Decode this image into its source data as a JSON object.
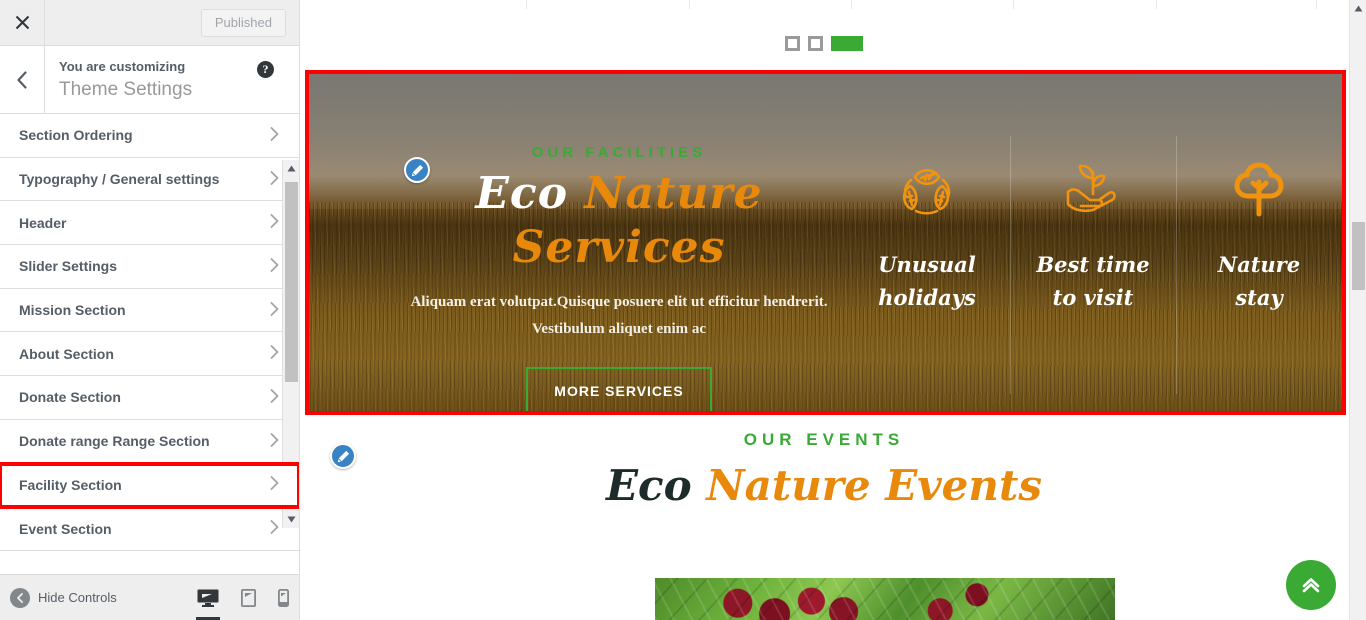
{
  "customizer": {
    "close_label": "Close",
    "publish_label": "Published",
    "back_label": "Back",
    "subtitle": "You are customizing",
    "title": "Theme Settings",
    "help_label": "?",
    "hide_controls_label": "Hide Controls",
    "sections": [
      {
        "label": "Section Ordering",
        "highlighted": false
      },
      {
        "label": "Typography / General settings",
        "highlighted": false
      },
      {
        "label": "Header",
        "highlighted": false
      },
      {
        "label": "Slider Settings",
        "highlighted": false
      },
      {
        "label": "Mission Section",
        "highlighted": false
      },
      {
        "label": "About Section",
        "highlighted": false
      },
      {
        "label": "Donate Section",
        "highlighted": false
      },
      {
        "label": "Donate range Range Section",
        "highlighted": false
      },
      {
        "label": "Facility Section",
        "highlighted": true
      },
      {
        "label": "Event Section",
        "highlighted": false
      }
    ],
    "devices": [
      {
        "name": "desktop",
        "active": true
      },
      {
        "name": "tablet",
        "active": false
      },
      {
        "name": "mobile",
        "active": false
      }
    ]
  },
  "preview": {
    "slider_dots": [
      {
        "type": "square",
        "active": false
      },
      {
        "type": "square",
        "active": false
      },
      {
        "type": "bar",
        "active": true
      }
    ],
    "facility": {
      "highlighted": true,
      "eyebrow": "OUR FACILITIES",
      "title_part1": "Eco",
      "title_part2": "Nature Services",
      "description": "Aliquam erat volutpat.Quisque posuere elit ut efficitur hendrerit. Vestibulum aliquet enim ac",
      "button_label": "MORE SERVICES",
      "columns": [
        {
          "icon": "recycle-leaves-icon",
          "label_line1": "Unusual",
          "label_line2": "holidays"
        },
        {
          "icon": "hand-sprout-icon",
          "label_line1": "Best time",
          "label_line2": "to visit"
        },
        {
          "icon": "tree-icon",
          "label_line1": "Nature",
          "label_line2": "stay"
        }
      ]
    },
    "events": {
      "eyebrow": "OUR EVENTS",
      "title_part1": "Eco",
      "title_part2": "Nature Events"
    },
    "scroll_top_label": "Scroll to top"
  },
  "colors": {
    "green": "#3aaa35",
    "orange": "#e8890c",
    "highlight_red": "#ff0000",
    "edit_blue": "#3982c4",
    "sidebar_text": "#555d66"
  }
}
